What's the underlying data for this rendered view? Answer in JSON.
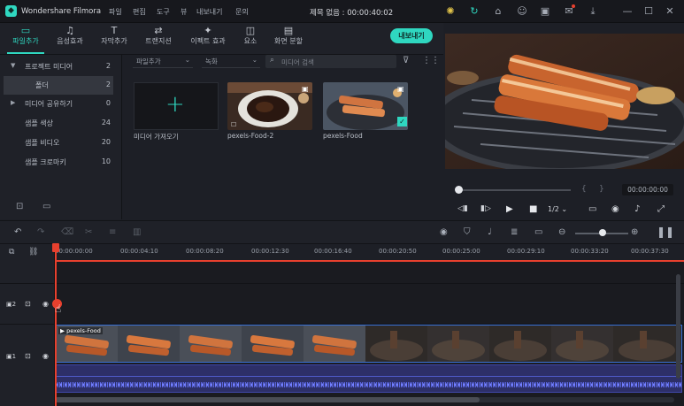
{
  "titlebar": {
    "app_name": "Wondershare Filmora",
    "menus": [
      "파일",
      "편집",
      "도구",
      "뷰",
      "내보내기",
      "문의"
    ],
    "project_title": "제목 없음 : 00:00:40:02",
    "icons": [
      "lightbulb-icon",
      "refresh-icon",
      "gift-icon",
      "account-icon",
      "save-icon",
      "mail-icon",
      "download-icon",
      "minimize-icon",
      "maximize-icon",
      "close-icon"
    ]
  },
  "tabs": [
    {
      "label": "파일추가",
      "icon": "folder-icon",
      "active": true
    },
    {
      "label": "음성효과",
      "icon": "music-icon",
      "active": false
    },
    {
      "label": "자막추가",
      "icon": "text-icon",
      "active": false
    },
    {
      "label": "트랜지션",
      "icon": "transition-icon",
      "active": false
    },
    {
      "label": "이펙트 효과",
      "icon": "effects-icon",
      "active": false
    },
    {
      "label": "요소",
      "icon": "elements-icon",
      "active": false
    },
    {
      "label": "화면 분할",
      "icon": "split-screen-icon",
      "active": false
    }
  ],
  "export_label": "내보내기",
  "left_panel": {
    "items": [
      {
        "label": "프로젝트 미디어",
        "count": "2",
        "expand": "▼"
      },
      {
        "label": "폴더",
        "count": "2",
        "expand": ""
      },
      {
        "label": "미디어 공유하기",
        "count": "0",
        "expand": "▶"
      },
      {
        "label": "샘플 색상",
        "count": "24",
        "expand": ""
      },
      {
        "label": "샘플 비디오",
        "count": "20",
        "expand": ""
      },
      {
        "label": "샘플 크로마키",
        "count": "10",
        "expand": ""
      }
    ]
  },
  "media": {
    "dropdown1": "파일추가",
    "dropdown2": "녹화",
    "search_placeholder": "미디어 검색",
    "import_label": "미디어 가져오기",
    "items": [
      {
        "label": "pexels-Food-2"
      },
      {
        "label": "pexels-Food"
      }
    ]
  },
  "preview": {
    "timecode": "00:00:00:00",
    "speed": "1/2"
  },
  "timeline": {
    "ticks": [
      "00:00:00:00",
      "00:00:04:10",
      "00:00:08:20",
      "00:00:12:30",
      "00:00:16:40",
      "00:00:20:50",
      "00:00:25:00",
      "00:00:29:10",
      "00:00:33:20",
      "00:00:37:30"
    ],
    "clip_label": "pexels-Food",
    "track1": "2",
    "track2": "1"
  },
  "colors": {
    "accent": "#2fd7c0",
    "playhead": "#e8402e",
    "clip_border": "#3a72d8",
    "audio": "#2d2f68"
  }
}
